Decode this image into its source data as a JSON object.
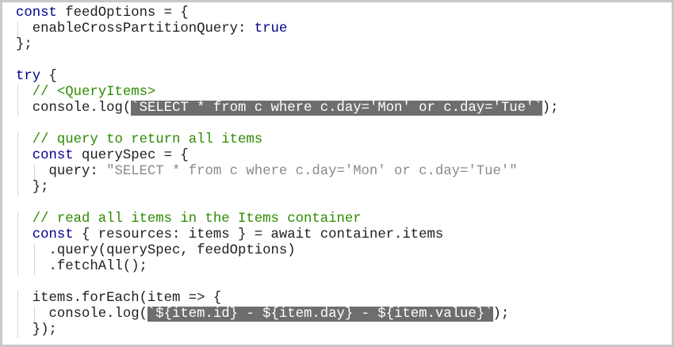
{
  "lines": [
    {
      "indent": 0,
      "segments": [
        {
          "t": "const",
          "c": "kw"
        },
        {
          "t": " feedOptions = {",
          "c": "pl"
        }
      ]
    },
    {
      "indent": 1,
      "segments": [
        {
          "t": "enableCrossPartitionQuery: ",
          "c": "pl"
        },
        {
          "t": "true",
          "c": "kw"
        }
      ]
    },
    {
      "indent": 0,
      "segments": [
        {
          "t": "};",
          "c": "pl"
        }
      ]
    },
    {
      "indent": 0,
      "segments": []
    },
    {
      "indent": 0,
      "segments": [
        {
          "t": "try",
          "c": "kw"
        },
        {
          "t": " {",
          "c": "pl"
        }
      ]
    },
    {
      "indent": 1,
      "segments": [
        {
          "t": "// <QueryItems>",
          "c": "cm"
        }
      ]
    },
    {
      "indent": 1,
      "segments": [
        {
          "t": "console.log(",
          "c": "pl"
        },
        {
          "t": "`SELECT * from c where c.day='Mon' or c.day='Tue'`",
          "c": "tpl"
        },
        {
          "t": ");",
          "c": "pl"
        }
      ]
    },
    {
      "indent": 0,
      "segments": []
    },
    {
      "indent": 1,
      "segments": [
        {
          "t": "// query to return all items",
          "c": "cm"
        }
      ]
    },
    {
      "indent": 1,
      "segments": [
        {
          "t": "const",
          "c": "kw"
        },
        {
          "t": " querySpec = {",
          "c": "pl"
        }
      ]
    },
    {
      "indent": 2,
      "segments": [
        {
          "t": "query: ",
          "c": "pl"
        },
        {
          "t": "\"SELECT * from c where c.day='Mon' or c.day='Tue'\"",
          "c": "str"
        }
      ]
    },
    {
      "indent": 1,
      "segments": [
        {
          "t": "};",
          "c": "pl"
        }
      ]
    },
    {
      "indent": 0,
      "segments": []
    },
    {
      "indent": 1,
      "segments": [
        {
          "t": "// read all items in the Items container",
          "c": "cm"
        }
      ]
    },
    {
      "indent": 1,
      "segments": [
        {
          "t": "const",
          "c": "kw"
        },
        {
          "t": " { resources: items } = await container.items",
          "c": "pl"
        }
      ]
    },
    {
      "indent": 2,
      "segments": [
        {
          "t": ".query(querySpec, feedOptions)",
          "c": "pl"
        }
      ]
    },
    {
      "indent": 2,
      "segments": [
        {
          "t": ".fetchAll();",
          "c": "pl"
        }
      ]
    },
    {
      "indent": 0,
      "segments": []
    },
    {
      "indent": 1,
      "segments": [
        {
          "t": "items.forEach(item => {",
          "c": "pl"
        }
      ]
    },
    {
      "indent": 2,
      "segments": [
        {
          "t": "console.log(",
          "c": "pl"
        },
        {
          "t": "`${item.id} - ${item.day} - ${item.value}`",
          "c": "tpl"
        },
        {
          "t": ");",
          "c": "pl"
        }
      ]
    },
    {
      "indent": 1,
      "segments": [
        {
          "t": "});",
          "c": "pl"
        }
      ]
    }
  ],
  "colors": {
    "keyword": "#00008b",
    "comment": "#2e8b00",
    "string": "#8a8a8a",
    "text": "#1e1e1e",
    "highlight_bg": "#6e6e6e",
    "highlight_fg": "#ffffff",
    "indent_guide": "#d4d4d4",
    "frame_border": "#c8c8c8"
  }
}
